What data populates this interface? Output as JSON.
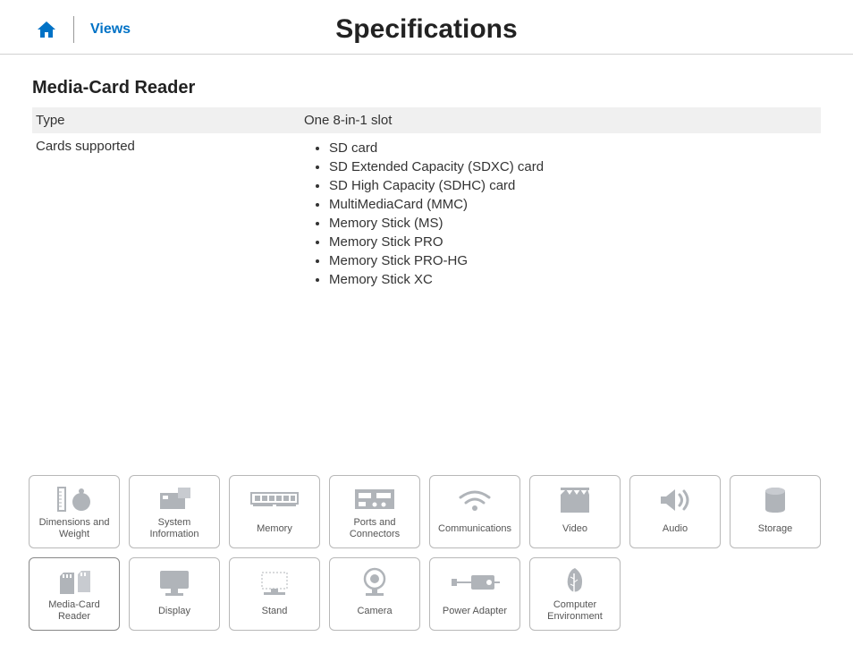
{
  "header": {
    "views_label": "Views",
    "page_title": "Specifications"
  },
  "section": {
    "title": "Media-Card Reader",
    "rows": [
      {
        "label": "Type",
        "value": "One 8-in-1 slot"
      },
      {
        "label": "Cards supported"
      }
    ],
    "cards_supported": [
      "SD card",
      "SD Extended Capacity (SDXC) card",
      "SD High Capacity (SDHC) card",
      "MultiMediaCard (MMC)",
      "Memory Stick (MS)",
      "Memory Stick PRO",
      "Memory Stick PRO-HG",
      "Memory Stick XC"
    ]
  },
  "tiles": [
    {
      "id": "dimensions-weight",
      "label": "Dimensions and Weight"
    },
    {
      "id": "system-information",
      "label": "System Information"
    },
    {
      "id": "memory",
      "label": "Memory"
    },
    {
      "id": "ports-connectors",
      "label": "Ports and Connectors"
    },
    {
      "id": "communications",
      "label": "Communications"
    },
    {
      "id": "video",
      "label": "Video"
    },
    {
      "id": "audio",
      "label": "Audio"
    },
    {
      "id": "storage",
      "label": "Storage"
    },
    {
      "id": "media-card-reader",
      "label": "Media-Card Reader"
    },
    {
      "id": "display",
      "label": "Display"
    },
    {
      "id": "stand",
      "label": "Stand"
    },
    {
      "id": "camera",
      "label": "Camera"
    },
    {
      "id": "power-adapter",
      "label": "Power Adapter"
    },
    {
      "id": "computer-environment",
      "label": "Computer Environment"
    }
  ]
}
